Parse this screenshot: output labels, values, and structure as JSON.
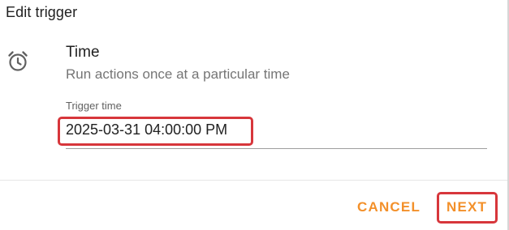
{
  "dialog": {
    "title": "Edit trigger"
  },
  "trigger": {
    "icon": "alarm-clock-icon",
    "name": "Time",
    "description": "Run actions once at a particular time"
  },
  "field": {
    "label": "Trigger time",
    "value": "2025-03-31 04:00:00 PM"
  },
  "buttons": {
    "cancel_label": "CANCEL",
    "next_label": "NEXT"
  },
  "colors": {
    "accent": "#f3902a",
    "highlight": "#d7363b",
    "text_primary": "#212121",
    "text_secondary": "#757575"
  }
}
